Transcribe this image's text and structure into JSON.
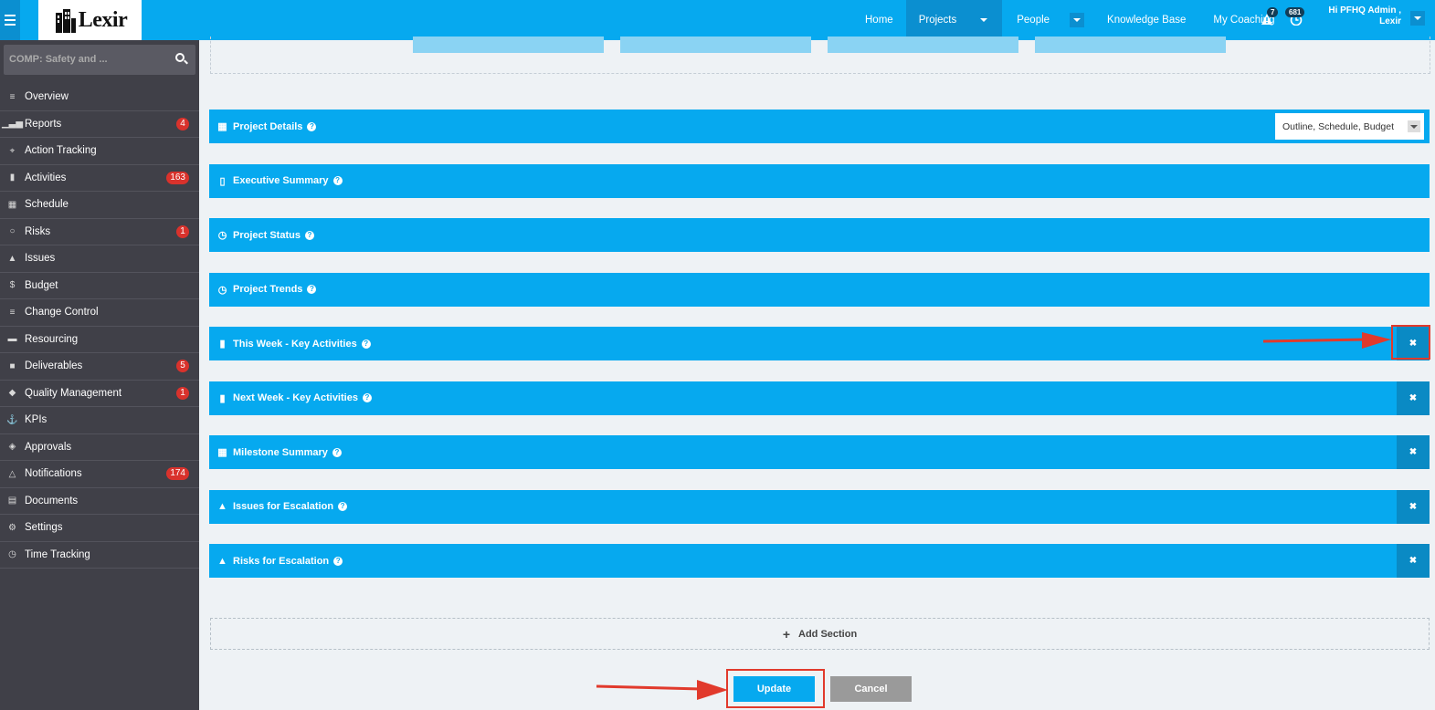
{
  "header": {
    "logo": "Lexir",
    "nav": [
      {
        "label": "Home"
      },
      {
        "label": "Projects"
      },
      {
        "label": "People"
      },
      {
        "label": "Knowledge Base"
      },
      {
        "label": "My Coaching"
      }
    ],
    "alerts_count": "7",
    "notifications_count": "681",
    "user_greeting_line1": "Hi PFHQ Admin ,",
    "user_greeting_line2": "Lexir"
  },
  "sidebar": {
    "search_value": "COMP: Safety and ...",
    "items": [
      {
        "label": "Overview",
        "icon": "list-icon",
        "badge": null
      },
      {
        "label": "Reports",
        "icon": "bar-chart-icon",
        "badge": "4"
      },
      {
        "label": "Action Tracking",
        "icon": "crosshair-icon",
        "badge": null
      },
      {
        "label": "Activities",
        "icon": "bookmark-icon",
        "badge": "163"
      },
      {
        "label": "Schedule",
        "icon": "calendar-icon",
        "badge": null
      },
      {
        "label": "Risks",
        "icon": "lightbulb-icon",
        "badge": "1"
      },
      {
        "label": "Issues",
        "icon": "warning-icon",
        "badge": null
      },
      {
        "label": "Budget",
        "icon": "dollar-icon",
        "badge": null
      },
      {
        "label": "Change Control",
        "icon": "list-icon",
        "badge": null
      },
      {
        "label": "Resourcing",
        "icon": "folder-icon",
        "badge": null
      },
      {
        "label": "Deliverables",
        "icon": "truck-icon",
        "badge": "5"
      },
      {
        "label": "Quality Management",
        "icon": "tag-icon",
        "badge": "1"
      },
      {
        "label": "KPIs",
        "icon": "anchor-icon",
        "badge": null
      },
      {
        "label": "Approvals",
        "icon": "ticket-icon",
        "badge": null
      },
      {
        "label": "Notifications",
        "icon": "bell-icon",
        "badge": "174"
      },
      {
        "label": "Documents",
        "icon": "files-icon",
        "badge": null
      },
      {
        "label": "Settings",
        "icon": "cogs-icon",
        "badge": null
      },
      {
        "label": "Time Tracking",
        "icon": "clock-icon",
        "badge": null
      }
    ]
  },
  "sections": [
    {
      "title": "Project Details",
      "icon": "calendar-icon",
      "select": "Outline, Schedule, Budget",
      "closable": false
    },
    {
      "title": "Executive Summary",
      "icon": "file-icon",
      "closable": false
    },
    {
      "title": "Project Status",
      "icon": "clock-icon",
      "closable": false
    },
    {
      "title": "Project Trends",
      "icon": "clock-icon",
      "closable": false
    },
    {
      "title": "This Week - Key Activities",
      "icon": "bookmark-icon",
      "closable": true
    },
    {
      "title": "Next Week - Key Activities",
      "icon": "bookmark-icon",
      "closable": true
    },
    {
      "title": "Milestone Summary",
      "icon": "calendar-icon",
      "closable": true
    },
    {
      "title": "Issues for Escalation",
      "icon": "warning-icon",
      "closable": true
    },
    {
      "title": "Risks for Escalation",
      "icon": "warning-icon",
      "closable": true
    }
  ],
  "add_section_label": "Add Section",
  "buttons": {
    "update": "Update",
    "cancel": "Cancel"
  },
  "colors": {
    "accent": "#06a9ef",
    "sidebar": "#404048",
    "badge": "#d9322c",
    "annotation": "#e13a2c"
  }
}
